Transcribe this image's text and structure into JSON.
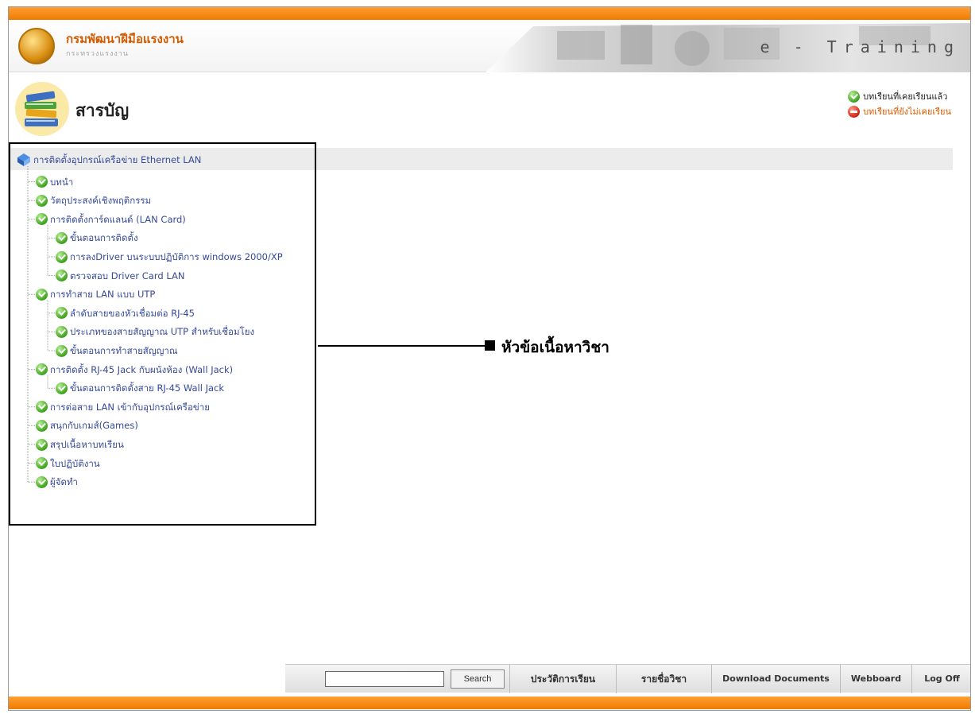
{
  "header": {
    "org_name": "กรมพัฒนาฝีมือแรงงาน",
    "org_sub": "กระทรวงแรงงาน",
    "banner_text": "e - Training"
  },
  "page_title": "สารบัญ",
  "legend": {
    "completed": "บทเรียนที่เคยเรียนแล้ว",
    "not_completed": "บทเรียนที่ยังไม่เคยเรียน"
  },
  "tree": {
    "root": "การติดตั้งอุปกรณ์เครือข่าย Ethernet LAN",
    "items": [
      {
        "label": "บทนำ",
        "level": 1,
        "status": "completed"
      },
      {
        "label": "วัตถุประสงค์เชิงพฤติกรรม",
        "level": 1,
        "status": "completed"
      },
      {
        "label": "การติดตั้งการ์ดแลนด์ (LAN Card)",
        "level": 1,
        "status": "completed"
      },
      {
        "label": "ขั้นตอนการติดตั้ง",
        "level": 2,
        "status": "completed"
      },
      {
        "label": "การลงDriver บนระบบปฏิบัติการ windows 2000/XP",
        "level": 2,
        "status": "completed"
      },
      {
        "label": "ตรวจสอบ Driver Card LAN",
        "level": 2,
        "status": "completed"
      },
      {
        "label": "การทำสาย LAN แบบ UTP",
        "level": 1,
        "status": "completed"
      },
      {
        "label": "ลำดับสายของหัวเชื่อมต่อ RJ-45",
        "level": 2,
        "status": "completed"
      },
      {
        "label": "ประเภทของสายสัญญาณ UTP สำหรับเชื่อมโยง",
        "level": 2,
        "status": "completed"
      },
      {
        "label": "ขั้นตอนการทำสายสัญญาณ",
        "level": 2,
        "status": "completed"
      },
      {
        "label": "การติดตั้ง RJ-45 Jack กับผนังห้อง (Wall Jack)",
        "level": 1,
        "status": "completed"
      },
      {
        "label": "ขั้นตอนการติดตั้งสาย RJ-45 Wall Jack",
        "level": 2,
        "status": "completed"
      },
      {
        "label": "การต่อสาย LAN เข้ากับอุปกรณ์เครือข่าย",
        "level": 1,
        "status": "completed"
      },
      {
        "label": "สนุกกับเกมส์(Games)",
        "level": 1,
        "status": "completed"
      },
      {
        "label": "สรุปเนื้อหาบทเรียน",
        "level": 1,
        "status": "completed"
      },
      {
        "label": "ใบปฏิบัติงาน",
        "level": 1,
        "status": "completed"
      },
      {
        "label": "ผู้จัดทำ",
        "level": 1,
        "status": "completed"
      }
    ]
  },
  "annotation": {
    "text": "หัวข้อเนื้อหาวิชา"
  },
  "footer": {
    "search_value": "",
    "search_button": "Search",
    "history": "ประวัติการเรียน",
    "course_list": "รายชื่อวิชา",
    "download": "Download Documents",
    "webboard": "Webboard",
    "logoff": "Log Off"
  },
  "colors": {
    "accent_orange": "#f28a12",
    "tree_text": "#354a9a",
    "completed_green": "#3da31c",
    "not_completed_red": "#d42010"
  },
  "icons": {
    "completed": "green-check-icon",
    "not_completed": "red-minus-icon",
    "root": "blue-book-icon",
    "logo": "dsd-logo-icon",
    "title": "books-icon"
  }
}
